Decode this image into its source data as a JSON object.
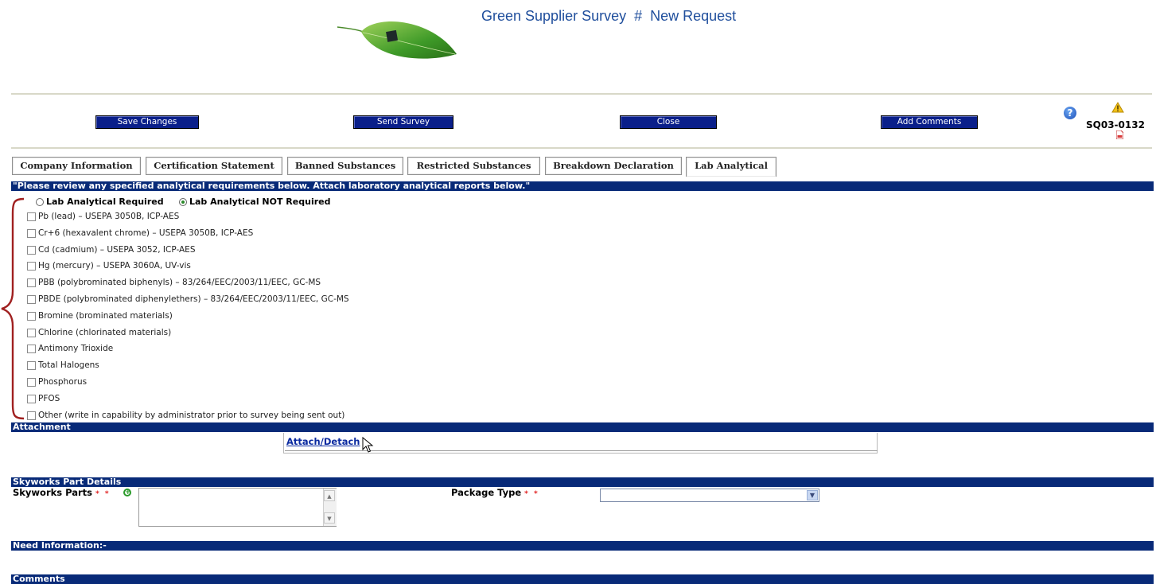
{
  "header": {
    "title_prefix": "Green Supplier Survey",
    "title_hash": "#",
    "title_status": "New Request"
  },
  "toolbar": {
    "save_label": "Save Changes",
    "send_label": "Send Survey",
    "close_label": "Close",
    "comments_label": "Add Comments",
    "survey_id": "SQ03-0132"
  },
  "tabs": [
    {
      "label": "Company Information"
    },
    {
      "label": "Certification Statement"
    },
    {
      "label": "Banned Substances"
    },
    {
      "label": "Restricted Substances"
    },
    {
      "label": "Breakdown Declaration"
    },
    {
      "label": "Lab Analytical",
      "active": true
    }
  ],
  "lab": {
    "instruction": "\"Please review any specified analytical requirements below. Attach laboratory analytical reports below.\"",
    "radio_required": "Lab Analytical Required",
    "radio_not_required": "Lab Analytical NOT Required",
    "selected": "Lab Analytical NOT Required",
    "items": [
      {
        "label": "Pb (lead) – USEPA 3050B, ICP-AES",
        "checked": false
      },
      {
        "label": "Cr+6 (hexavalent chrome) – USEPA 3050B, ICP-AES",
        "checked": false
      },
      {
        "label": "Cd (cadmium) – USEPA 3052, ICP-AES",
        "checked": false
      },
      {
        "label": "Hg (mercury) – USEPA 3060A, UV-vis",
        "checked": false
      },
      {
        "label": "PBB (polybrominated biphenyls) – 83/264/EEC/2003/11/EEC, GC-MS",
        "checked": false
      },
      {
        "label": "PBDE (polybrominated diphenylethers) – 83/264/EEC/2003/11/EEC, GC-MS",
        "checked": false
      },
      {
        "label": "Bromine (brominated materials)",
        "checked": false
      },
      {
        "label": "Chlorine (chlorinated materials)",
        "checked": false
      },
      {
        "label": "Antimony Trioxide",
        "checked": false
      },
      {
        "label": "Total Halogens",
        "checked": false
      },
      {
        "label": "Phosphorus",
        "checked": false
      },
      {
        "label": "PFOS",
        "checked": false
      },
      {
        "label": "Other (write in capability by administrator prior to survey being sent out)",
        "checked": false
      }
    ]
  },
  "attachment": {
    "heading": "Attachment",
    "link": "Attach/Detach"
  },
  "parts": {
    "heading": "Skyworks Part Details",
    "parts_label": "Skyworks Parts",
    "required_mark": "* *",
    "package_label": "Package Type",
    "package_value": ""
  },
  "need_info": {
    "heading": "Need Information:-"
  },
  "comments": {
    "heading": "Comments"
  },
  "icons": [
    "leaf-logo",
    "help-icon",
    "warning-icon",
    "pdf-icon",
    "add-icon",
    "chevron-down-icon",
    "cursor-icon"
  ],
  "colors": {
    "bar": "#082a78",
    "button": "#0a1f8a",
    "title": "#1f4e9c",
    "brace": "#a02020"
  }
}
